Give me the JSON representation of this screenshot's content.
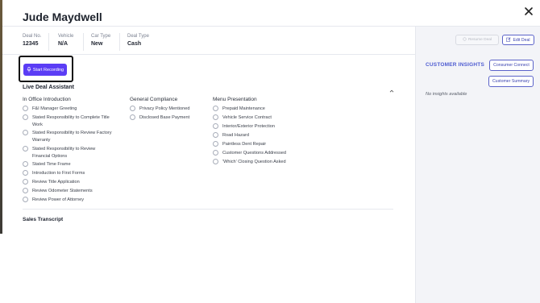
{
  "header": {
    "title": "Jude Maydwell"
  },
  "deal_info": [
    {
      "label": "Deal No.",
      "value": "12345"
    },
    {
      "label": "Vehicle",
      "value": "N/A"
    },
    {
      "label": "Car Type",
      "value": "New"
    },
    {
      "label": "Deal Type",
      "value": "Cash"
    }
  ],
  "recording": {
    "start_label": "Start Recording"
  },
  "assistant": {
    "title": "Live Deal Assistant",
    "columns": [
      {
        "title": "In Office Introduction",
        "items": [
          "F&I Manager Greeting",
          "Stated Responsibility to Complete Title Work",
          "Stated Responsibility to Review Factory Warranty",
          "Stated Responsibility to Review Financial Options",
          "Stated Time Frame",
          "Introduction to First Forms",
          "Review Title Application",
          "Review Odometer Statements",
          "Review Power of Attorney"
        ]
      },
      {
        "title": "General Compliance",
        "items": [
          "Privacy Policy Mentioned",
          "Disclosed Base Payment"
        ]
      },
      {
        "title": "Menu Presentation",
        "items": [
          "Prepaid Maintenance",
          "Vehicle Service Contract",
          "Interior/Exterior Protection",
          "Road Hazard",
          "Paintless Dent Repair",
          "Customer Questions Addressed",
          "'Which' Closing Question Asked"
        ]
      }
    ]
  },
  "transcript": {
    "title": "Sales Transcript"
  },
  "sidebar": {
    "resume_label": "Resume Deal",
    "edit_label": "Edit Deal",
    "insights_title": "CUSTOMER INSIGHTS",
    "consumer_connect_label": "Consumer Connect",
    "customer_summary_label": "Customer Summary",
    "no_insights": "No insights available"
  },
  "colors": {
    "accent": "#5b3df5",
    "link": "#4d5bd1",
    "panel_bg": "#f3f4f8"
  }
}
